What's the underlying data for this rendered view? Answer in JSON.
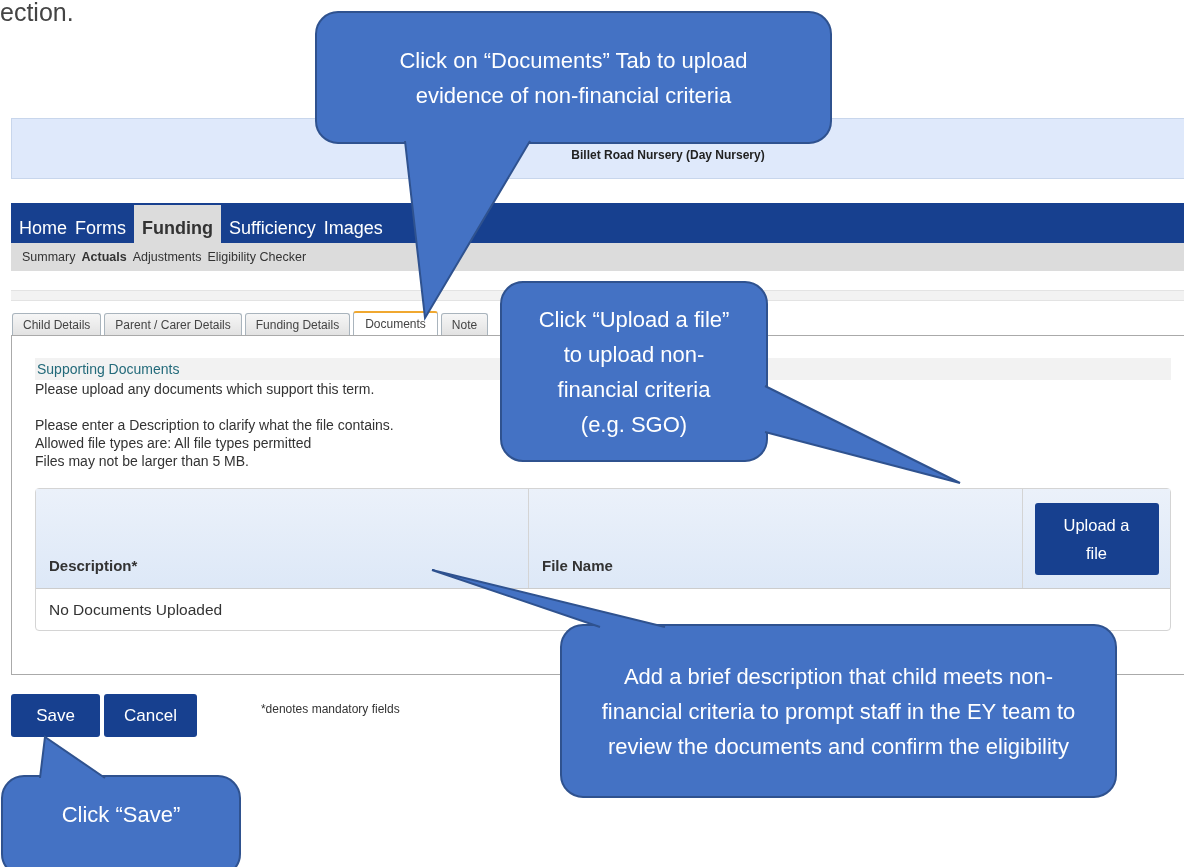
{
  "page_fragment": "ection.",
  "header": {
    "title": "Billet Road Nursery (Day Nursery)"
  },
  "nav": [
    {
      "label": "Home",
      "selected": false
    },
    {
      "label": "Forms",
      "selected": false
    },
    {
      "label": "Funding",
      "selected": true
    },
    {
      "label": "Sufficiency",
      "selected": false
    },
    {
      "label": "Images",
      "selected": false
    }
  ],
  "subnav": [
    {
      "label": "Summary",
      "selected": false
    },
    {
      "label": "Actuals",
      "selected": true
    },
    {
      "label": "Adjustments",
      "selected": false
    },
    {
      "label": "Eligibility Checker",
      "selected": false
    }
  ],
  "tabs": [
    {
      "label": "Child Details",
      "selected": false
    },
    {
      "label": "Parent / Carer Details",
      "selected": false
    },
    {
      "label": "Funding Details",
      "selected": false
    },
    {
      "label": "Documents",
      "selected": true
    },
    {
      "label": "Note",
      "selected": false
    }
  ],
  "section": {
    "title": "Supporting Documents",
    "paragraphs": [
      [
        "Please upload any documents which support this term."
      ],
      [
        "Please enter a Description to clarify what the file contains.",
        "Allowed file types are: All file types permitted",
        "Files may not be larger than 5 MB."
      ]
    ]
  },
  "table": {
    "columns": [
      "Description*",
      "File Name"
    ],
    "upload_button": "Upload a file",
    "empty_message": "No Documents Uploaded"
  },
  "actions": [
    "Save",
    "Cancel"
  ],
  "footnote": "*denotes mandatory fields",
  "callouts": [
    {
      "text": "Click on “Documents” Tab to upload evidence of non-financial criteria"
    },
    {
      "text": "Click “Upload a file” to upload non-financial criteria (e.g. SGO)"
    },
    {
      "text": "Add a brief description that child meets non-financial criteria to prompt staff in the EY team to review the documents and confirm the eligibility"
    },
    {
      "text": "Click “Save”"
    }
  ]
}
